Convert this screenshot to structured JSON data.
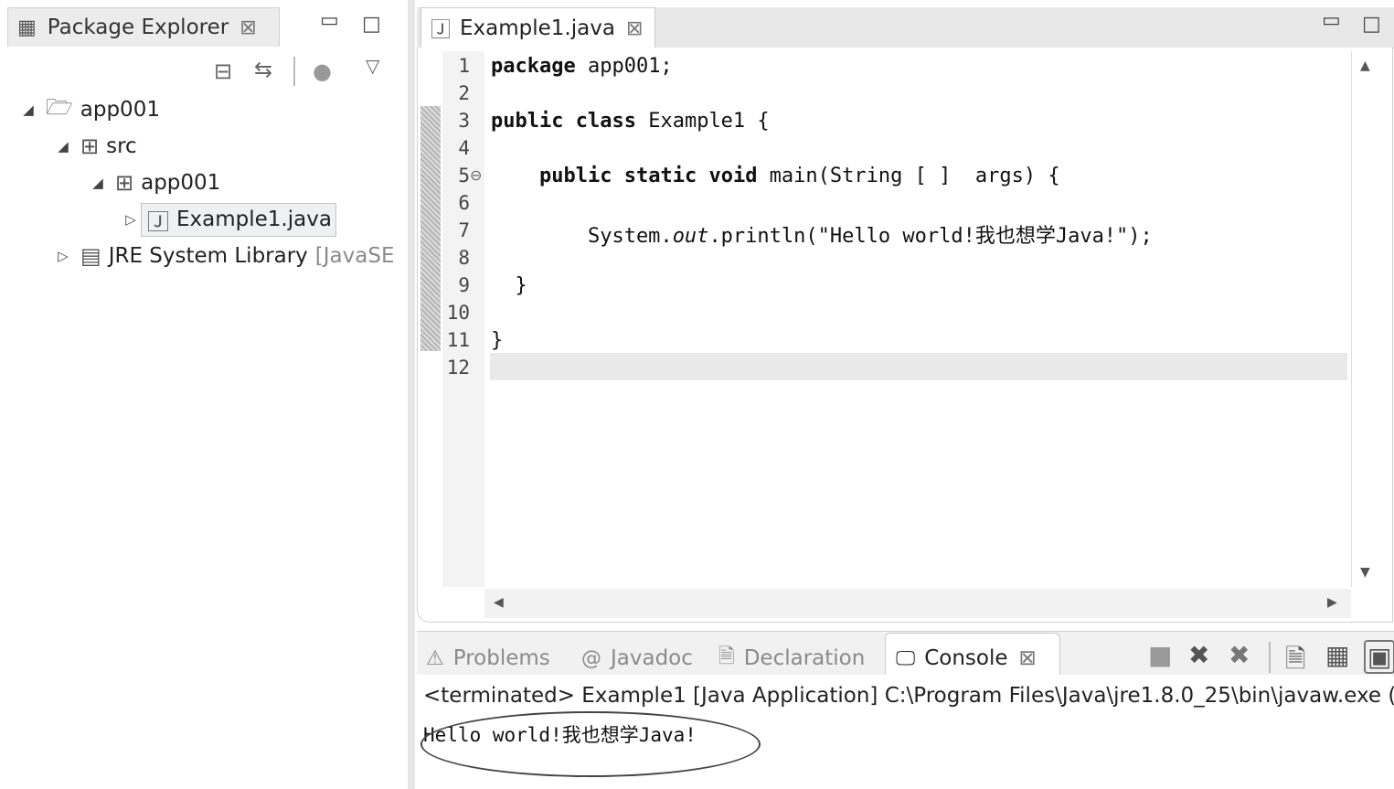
{
  "package_explorer": {
    "title": "Package Explorer",
    "close_glyph": "⊠",
    "tree": {
      "project": "app001",
      "src": "src",
      "package": "app001",
      "file": "Example1.java",
      "library": "JRE System Library",
      "library_suffix": "[JavaSE"
    }
  },
  "editor": {
    "tab_title": "Example1.java",
    "line_numbers": [
      "1",
      "2",
      "3",
      "4",
      "5",
      "6",
      "7",
      "8",
      "9",
      "10",
      "11",
      "12"
    ],
    "code_lines": [
      "package app001;",
      "",
      "public class Example1 {",
      "",
      "    public static void main(String [ ]  args) {",
      "",
      "        System.out.println(\"Hello world!我也想学Java!\");",
      "",
      "  }",
      "",
      "}",
      ""
    ],
    "fold_marker": "⊖"
  },
  "console": {
    "tabs": [
      "Problems",
      "Javadoc",
      "Declaration",
      "Console"
    ],
    "active_tab": "Console",
    "status": "<terminated> Example1 [Java Application] C:\\Program Files\\Java\\jre1.8.0_25\\bin\\javaw.exe (",
    "output": "Hello world!我也想学Java!"
  },
  "icons": [
    "package-explorer-icon",
    "minimize-icon",
    "maximize-icon",
    "collapse-all-icon",
    "link-editor-icon",
    "focus-icon",
    "view-menu-icon",
    "project-folder-icon",
    "source-folder-icon",
    "package-icon",
    "java-file-icon",
    "library-icon",
    "problems-icon",
    "javadoc-icon",
    "declaration-icon",
    "console-icon",
    "terminate-icon",
    "remove-launch-icon",
    "remove-all-icon",
    "clear-console-icon",
    "scroll-lock-icon",
    "display-console-icon"
  ]
}
